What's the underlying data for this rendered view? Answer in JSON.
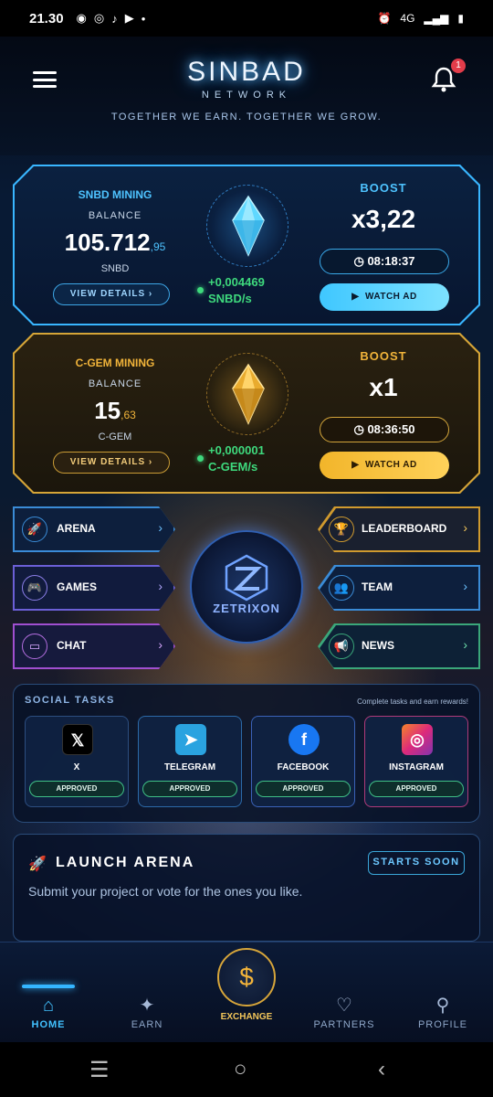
{
  "status_bar": {
    "time": "21.30",
    "network": "4G"
  },
  "header": {
    "brand": "SINBAD",
    "brand_sub": "NETWORK",
    "tagline": "TOGETHER WE EARN. TOGETHER WE GROW.",
    "notification_count": "1"
  },
  "snbd_panel": {
    "title": "SNBD MINING",
    "balance_label": "BALANCE",
    "balance_int": "105.712",
    "balance_dec": ",95",
    "unit": "SNBD",
    "details_label": "VIEW DETAILS",
    "rate": "+0,004469",
    "rate_unit": "SNBD/s",
    "boost_label": "BOOST",
    "boost_value": "x3,22",
    "timer": "08:18:37",
    "watch_label": "WATCH AD"
  },
  "cgem_panel": {
    "title": "C-GEM MINING",
    "balance_label": "BALANCE",
    "balance_int": "15",
    "balance_dec": ",63",
    "unit": "C-GEM",
    "details_label": "VIEW DETAILS",
    "rate": "+0,000001",
    "rate_unit": "C-GEM/s",
    "boost_label": "BOOST",
    "boost_value": "x1",
    "timer": "08:36:50",
    "watch_label": "WATCH AD"
  },
  "nav": {
    "arena": "ARENA",
    "games": "GAMES",
    "chat": "CHAT",
    "leaderboard": "LEADERBOARD",
    "team": "TEAM",
    "news": "NEWS",
    "center_logo": "ZETRIXON"
  },
  "social_tasks": {
    "heading": "SOCIAL TASKS",
    "subheading": "Complete tasks and earn rewards!",
    "items": [
      {
        "name": "X",
        "status": "APPROVED"
      },
      {
        "name": "TELEGRAM",
        "status": "APPROVED"
      },
      {
        "name": "FACEBOOK",
        "status": "APPROVED"
      },
      {
        "name": "INSTAGRAM",
        "status": "APPROVED"
      }
    ]
  },
  "launch_arena": {
    "title": "LAUNCH ARENA",
    "badge": "STARTS SOON",
    "description": "Submit your project or vote for the ones you like."
  },
  "bottom_nav": {
    "home": "HOME",
    "earn": "EARN",
    "exchange": "EXCHANGE",
    "partners": "PARTNERS",
    "profile": "PROFILE"
  },
  "colors": {
    "accent_blue": "#39b6ff",
    "accent_gold": "#d6a537",
    "rate_green": "#3ed97d"
  }
}
